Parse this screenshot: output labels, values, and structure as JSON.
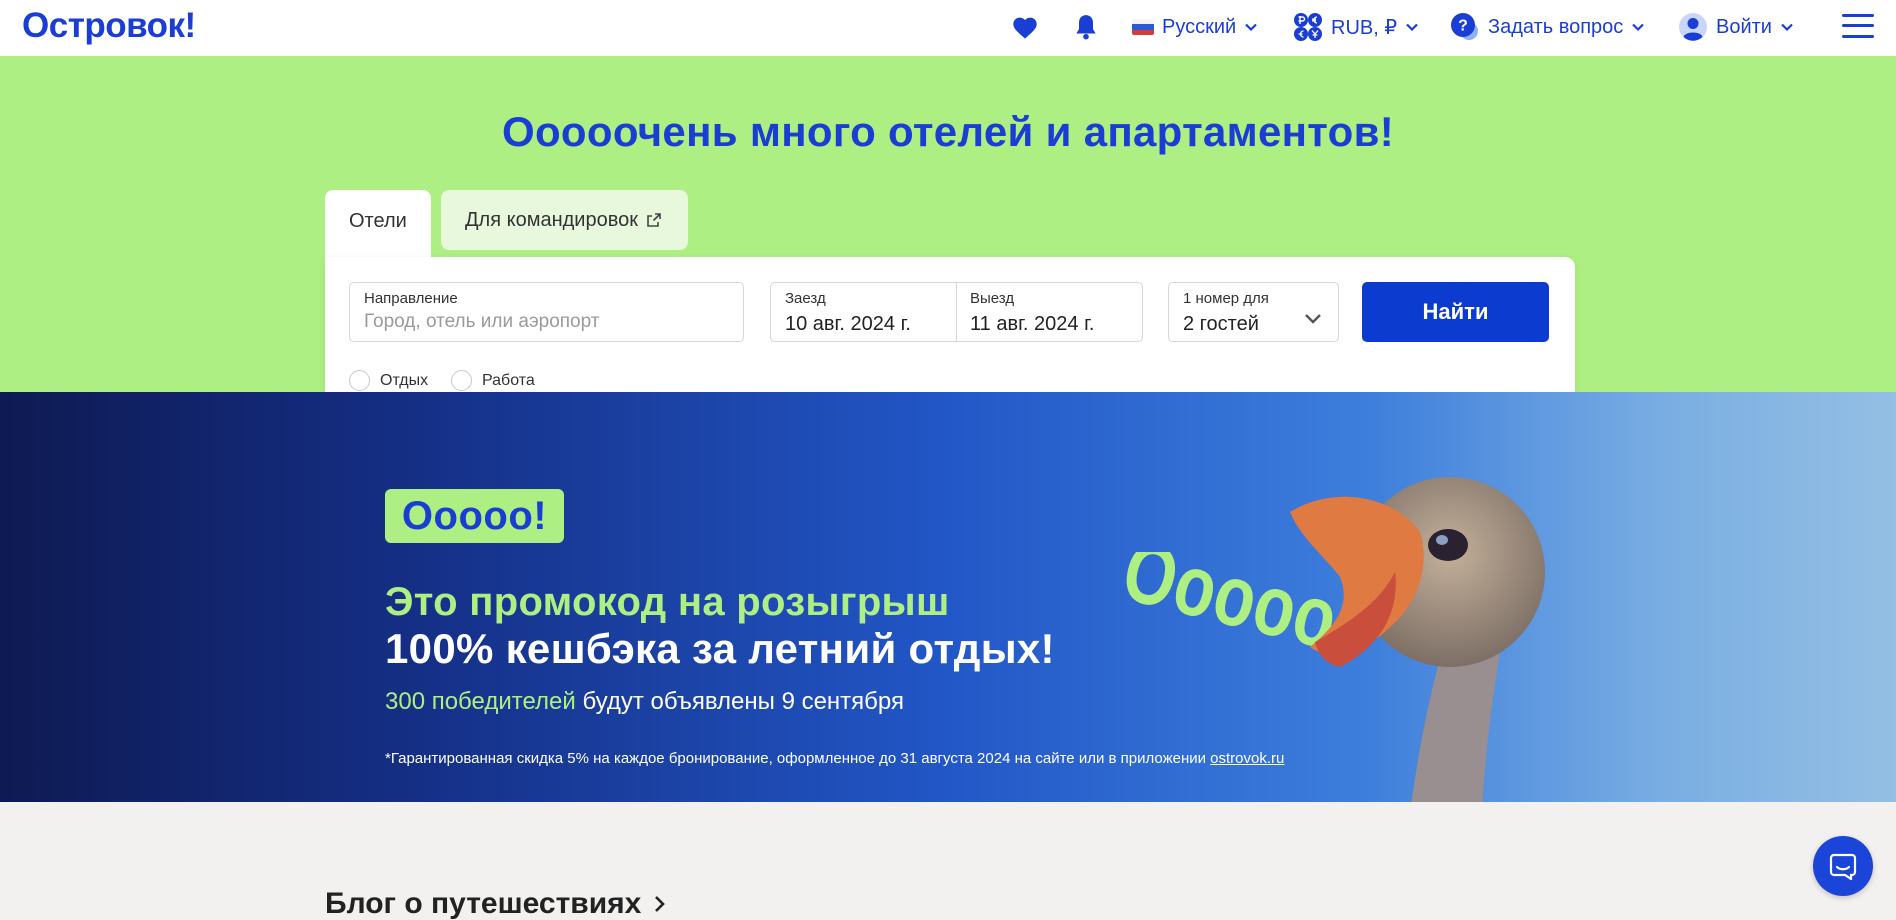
{
  "header": {
    "logo": "Островок!",
    "language": "Русский",
    "currency": "RUB, ₽",
    "help": "Задать вопрос",
    "login": "Войти"
  },
  "hero": {
    "title": "Ооооочень много отелей и апартаментов!"
  },
  "tabs": [
    {
      "label": "Отели"
    },
    {
      "label": "Для командировок"
    }
  ],
  "search": {
    "destination_label": "Направление",
    "destination_placeholder": "Город, отель или аэропорт",
    "checkin_label": "Заезд",
    "checkin_value": "10 авг. 2024 г.",
    "checkout_label": "Выезд",
    "checkout_value": "11 авг. 2024 г.",
    "guests_label": "1 номер для",
    "guests_value": "2 гостей",
    "find_button": "Найти",
    "purpose_options": [
      "Отдых",
      "Работа"
    ]
  },
  "promo": {
    "badge": "Ооооо!",
    "line1": "Это промокод на розыгрыш",
    "line2": "100% кешбэка за летний отдых!",
    "winners_highlight": "300 победителей",
    "winners_rest": " будут объявлены 9 сентября",
    "note": "*Гарантированная скидка 5% на каждое бронирование, оформленное до 31 августа 2024 на сайте или в приложении ",
    "note_link": "ostrovok.ru",
    "art_text": "Ooooo!"
  },
  "blog": {
    "title": "Блог о путешествиях"
  },
  "colors": {
    "brand_blue": "#1a3ed3",
    "hero_green": "#aeef83",
    "button_blue": "#0c3ccf"
  }
}
